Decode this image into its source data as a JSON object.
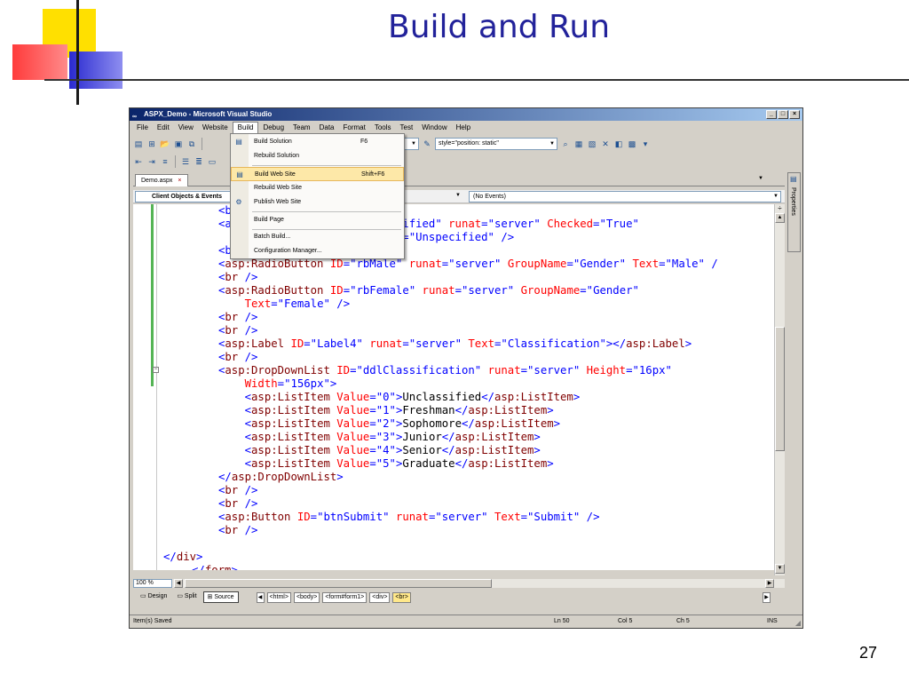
{
  "slide": {
    "title": "Build and Run",
    "page_number": "27"
  },
  "window": {
    "title": "ASPX_Demo - Microsoft Visual Studio",
    "buttons": [
      "_",
      "□",
      "×"
    ]
  },
  "menubar": {
    "items": [
      "File",
      "Edit",
      "View",
      "Website",
      "Build",
      "Debug",
      "Team",
      "Data",
      "Format",
      "Tools",
      "Test",
      "Window",
      "Help"
    ]
  },
  "toolbar": {
    "combo_target": "",
    "combo_style": "style=\"position: static\""
  },
  "document": {
    "tab_label": "Demo.aspx",
    "tab_close": "×",
    "nav_left": "Client Objects & Events",
    "nav_right": "(No Events)"
  },
  "build_menu": {
    "items": [
      {
        "label": "Build Solution",
        "shortcut": "F6",
        "icon": "build-solution-icon"
      },
      {
        "label": "Rebuild Solution",
        "shortcut": "",
        "icon": ""
      },
      {
        "label": "Build Web Site",
        "shortcut": "Shift+F6",
        "icon": "build-web-site-icon"
      },
      {
        "label": "Rebuild Web Site",
        "shortcut": "",
        "icon": ""
      },
      {
        "label": "Publish Web Site",
        "shortcut": "",
        "icon": "publish-icon"
      },
      {
        "label": "Build Page",
        "shortcut": "",
        "icon": ""
      },
      {
        "label": "Batch Build...",
        "shortcut": "",
        "icon": ""
      },
      {
        "label": "Configuration Manager...",
        "shortcut": "",
        "icon": ""
      }
    ]
  },
  "code": {
    "lines": [
      [
        {
          "t": "tag",
          "s": "<b"
        }
      ],
      [
        {
          "t": "tag",
          "s": "<a"
        },
        {
          "t": "pad",
          "s": "                      "
        },
        {
          "t": "val",
          "s": "specified\""
        },
        {
          "t": "text",
          "s": " "
        },
        {
          "t": "attr",
          "s": "runat"
        },
        {
          "t": "tag",
          "s": "="
        },
        {
          "t": "val",
          "s": "\"server\""
        },
        {
          "t": "text",
          "s": " "
        },
        {
          "t": "attr",
          "s": "Checked"
        },
        {
          "t": "tag",
          "s": "="
        },
        {
          "t": "val",
          "s": "\"True\""
        }
      ],
      [
        {
          "t": "pad",
          "s": "                          "
        },
        {
          "t": "val",
          "s": "xt=\"Unspecified\""
        },
        {
          "t": "text",
          "s": " "
        },
        {
          "t": "tag",
          "s": "/>"
        }
      ],
      [
        {
          "t": "tag",
          "s": "<b"
        }
      ],
      [
        {
          "t": "tag",
          "s": "<"
        },
        {
          "t": "el",
          "s": "asp:RadioButton"
        },
        {
          "t": "text",
          "s": " "
        },
        {
          "t": "attr",
          "s": "ID"
        },
        {
          "t": "tag",
          "s": "="
        },
        {
          "t": "val",
          "s": "\"rbMale\""
        },
        {
          "t": "text",
          "s": " "
        },
        {
          "t": "attr",
          "s": "runat"
        },
        {
          "t": "tag",
          "s": "="
        },
        {
          "t": "val",
          "s": "\"server\""
        },
        {
          "t": "text",
          "s": " "
        },
        {
          "t": "attr",
          "s": "GroupName"
        },
        {
          "t": "tag",
          "s": "="
        },
        {
          "t": "val",
          "s": "\"Gender\""
        },
        {
          "t": "text",
          "s": " "
        },
        {
          "t": "attr",
          "s": "Text"
        },
        {
          "t": "tag",
          "s": "="
        },
        {
          "t": "val",
          "s": "\"Male\""
        },
        {
          "t": "text",
          "s": " "
        },
        {
          "t": "tag",
          "s": "/"
        }
      ],
      [
        {
          "t": "tag",
          "s": "<"
        },
        {
          "t": "el",
          "s": "br"
        },
        {
          "t": "text",
          "s": " "
        },
        {
          "t": "tag",
          "s": "/>"
        }
      ],
      [
        {
          "t": "tag",
          "s": "<"
        },
        {
          "t": "el",
          "s": "asp:RadioButton"
        },
        {
          "t": "text",
          "s": " "
        },
        {
          "t": "attr",
          "s": "ID"
        },
        {
          "t": "tag",
          "s": "="
        },
        {
          "t": "val",
          "s": "\"rbFemale\""
        },
        {
          "t": "text",
          "s": " "
        },
        {
          "t": "attr",
          "s": "runat"
        },
        {
          "t": "tag",
          "s": "="
        },
        {
          "t": "val",
          "s": "\"server\""
        },
        {
          "t": "text",
          "s": " "
        },
        {
          "t": "attr",
          "s": "GroupName"
        },
        {
          "t": "tag",
          "s": "="
        },
        {
          "t": "val",
          "s": "\"Gender\""
        }
      ],
      [
        {
          "t": "pad",
          "s": "    "
        },
        {
          "t": "attr",
          "s": "Text"
        },
        {
          "t": "tag",
          "s": "="
        },
        {
          "t": "val",
          "s": "\"Female\""
        },
        {
          "t": "text",
          "s": " "
        },
        {
          "t": "tag",
          "s": "/>"
        }
      ],
      [
        {
          "t": "tag",
          "s": "<"
        },
        {
          "t": "el",
          "s": "br"
        },
        {
          "t": "text",
          "s": " "
        },
        {
          "t": "tag",
          "s": "/>"
        }
      ],
      [
        {
          "t": "tag",
          "s": "<"
        },
        {
          "t": "el",
          "s": "br"
        },
        {
          "t": "text",
          "s": " "
        },
        {
          "t": "tag",
          "s": "/>"
        }
      ],
      [
        {
          "t": "tag",
          "s": "<"
        },
        {
          "t": "el",
          "s": "asp:Label"
        },
        {
          "t": "text",
          "s": " "
        },
        {
          "t": "attr",
          "s": "ID"
        },
        {
          "t": "tag",
          "s": "="
        },
        {
          "t": "val",
          "s": "\"Label4\""
        },
        {
          "t": "text",
          "s": " "
        },
        {
          "t": "attr",
          "s": "runat"
        },
        {
          "t": "tag",
          "s": "="
        },
        {
          "t": "val",
          "s": "\"server\""
        },
        {
          "t": "text",
          "s": " "
        },
        {
          "t": "attr",
          "s": "Text"
        },
        {
          "t": "tag",
          "s": "="
        },
        {
          "t": "val",
          "s": "\"Classification\""
        },
        {
          "t": "tag",
          "s": "></"
        },
        {
          "t": "el",
          "s": "asp:Label"
        },
        {
          "t": "tag",
          "s": ">"
        }
      ],
      [
        {
          "t": "tag",
          "s": "<"
        },
        {
          "t": "el",
          "s": "br"
        },
        {
          "t": "text",
          "s": " "
        },
        {
          "t": "tag",
          "s": "/>"
        }
      ],
      [
        {
          "t": "tag",
          "s": "<"
        },
        {
          "t": "el",
          "s": "asp:DropDownList"
        },
        {
          "t": "text",
          "s": " "
        },
        {
          "t": "attr",
          "s": "ID"
        },
        {
          "t": "tag",
          "s": "="
        },
        {
          "t": "val",
          "s": "\"ddlClassification\""
        },
        {
          "t": "text",
          "s": " "
        },
        {
          "t": "attr",
          "s": "runat"
        },
        {
          "t": "tag",
          "s": "="
        },
        {
          "t": "val",
          "s": "\"server\""
        },
        {
          "t": "text",
          "s": " "
        },
        {
          "t": "attr",
          "s": "Height"
        },
        {
          "t": "tag",
          "s": "="
        },
        {
          "t": "val",
          "s": "\"16px\""
        }
      ],
      [
        {
          "t": "pad",
          "s": "    "
        },
        {
          "t": "attr",
          "s": "Width"
        },
        {
          "t": "tag",
          "s": "="
        },
        {
          "t": "val",
          "s": "\"156px\""
        },
        {
          "t": "tag",
          "s": ">"
        }
      ],
      [
        {
          "t": "pad",
          "s": "    "
        },
        {
          "t": "tag",
          "s": "<"
        },
        {
          "t": "el",
          "s": "asp:ListItem"
        },
        {
          "t": "text",
          "s": " "
        },
        {
          "t": "attr",
          "s": "Value"
        },
        {
          "t": "tag",
          "s": "="
        },
        {
          "t": "val",
          "s": "\"0\""
        },
        {
          "t": "tag",
          "s": ">"
        },
        {
          "t": "text",
          "s": "Unclassified"
        },
        {
          "t": "tag",
          "s": "</"
        },
        {
          "t": "el",
          "s": "asp:ListItem"
        },
        {
          "t": "tag",
          "s": ">"
        }
      ],
      [
        {
          "t": "pad",
          "s": "    "
        },
        {
          "t": "tag",
          "s": "<"
        },
        {
          "t": "el",
          "s": "asp:ListItem"
        },
        {
          "t": "text",
          "s": " "
        },
        {
          "t": "attr",
          "s": "Value"
        },
        {
          "t": "tag",
          "s": "="
        },
        {
          "t": "val",
          "s": "\"1\""
        },
        {
          "t": "tag",
          "s": ">"
        },
        {
          "t": "text",
          "s": "Freshman"
        },
        {
          "t": "tag",
          "s": "</"
        },
        {
          "t": "el",
          "s": "asp:ListItem"
        },
        {
          "t": "tag",
          "s": ">"
        }
      ],
      [
        {
          "t": "pad",
          "s": "    "
        },
        {
          "t": "tag",
          "s": "<"
        },
        {
          "t": "el",
          "s": "asp:ListItem"
        },
        {
          "t": "text",
          "s": " "
        },
        {
          "t": "attr",
          "s": "Value"
        },
        {
          "t": "tag",
          "s": "="
        },
        {
          "t": "val",
          "s": "\"2\""
        },
        {
          "t": "tag",
          "s": ">"
        },
        {
          "t": "text",
          "s": "Sophomore"
        },
        {
          "t": "tag",
          "s": "</"
        },
        {
          "t": "el",
          "s": "asp:ListItem"
        },
        {
          "t": "tag",
          "s": ">"
        }
      ],
      [
        {
          "t": "pad",
          "s": "    "
        },
        {
          "t": "tag",
          "s": "<"
        },
        {
          "t": "el",
          "s": "asp:ListItem"
        },
        {
          "t": "text",
          "s": " "
        },
        {
          "t": "attr",
          "s": "Value"
        },
        {
          "t": "tag",
          "s": "="
        },
        {
          "t": "val",
          "s": "\"3\""
        },
        {
          "t": "tag",
          "s": ">"
        },
        {
          "t": "text",
          "s": "Junior"
        },
        {
          "t": "tag",
          "s": "</"
        },
        {
          "t": "el",
          "s": "asp:ListItem"
        },
        {
          "t": "tag",
          "s": ">"
        }
      ],
      [
        {
          "t": "pad",
          "s": "    "
        },
        {
          "t": "tag",
          "s": "<"
        },
        {
          "t": "el",
          "s": "asp:ListItem"
        },
        {
          "t": "text",
          "s": " "
        },
        {
          "t": "attr",
          "s": "Value"
        },
        {
          "t": "tag",
          "s": "="
        },
        {
          "t": "val",
          "s": "\"4\""
        },
        {
          "t": "tag",
          "s": ">"
        },
        {
          "t": "text",
          "s": "Senior"
        },
        {
          "t": "tag",
          "s": "</"
        },
        {
          "t": "el",
          "s": "asp:ListItem"
        },
        {
          "t": "tag",
          "s": ">"
        }
      ],
      [
        {
          "t": "pad",
          "s": "    "
        },
        {
          "t": "tag",
          "s": "<"
        },
        {
          "t": "el",
          "s": "asp:ListItem"
        },
        {
          "t": "text",
          "s": " "
        },
        {
          "t": "attr",
          "s": "Value"
        },
        {
          "t": "tag",
          "s": "="
        },
        {
          "t": "val",
          "s": "\"5\""
        },
        {
          "t": "tag",
          "s": ">"
        },
        {
          "t": "text",
          "s": "Graduate"
        },
        {
          "t": "tag",
          "s": "</"
        },
        {
          "t": "el",
          "s": "asp:ListItem"
        },
        {
          "t": "tag",
          "s": ">"
        }
      ],
      [
        {
          "t": "tag",
          "s": "</"
        },
        {
          "t": "el",
          "s": "asp:DropDownList"
        },
        {
          "t": "tag",
          "s": ">"
        }
      ],
      [
        {
          "t": "tag",
          "s": "<"
        },
        {
          "t": "el",
          "s": "br"
        },
        {
          "t": "text",
          "s": " "
        },
        {
          "t": "tag",
          "s": "/>"
        }
      ],
      [
        {
          "t": "tag",
          "s": "<"
        },
        {
          "t": "el",
          "s": "br"
        },
        {
          "t": "text",
          "s": " "
        },
        {
          "t": "tag",
          "s": "/>"
        }
      ],
      [
        {
          "t": "tag",
          "s": "<"
        },
        {
          "t": "el",
          "s": "asp:Button"
        },
        {
          "t": "text",
          "s": " "
        },
        {
          "t": "attr",
          "s": "ID"
        },
        {
          "t": "tag",
          "s": "="
        },
        {
          "t": "val",
          "s": "\"btnSubmit\""
        },
        {
          "t": "text",
          "s": " "
        },
        {
          "t": "attr",
          "s": "runat"
        },
        {
          "t": "tag",
          "s": "="
        },
        {
          "t": "val",
          "s": "\"server\""
        },
        {
          "t": "text",
          "s": " "
        },
        {
          "t": "attr",
          "s": "Text"
        },
        {
          "t": "tag",
          "s": "="
        },
        {
          "t": "val",
          "s": "\"Submit\""
        },
        {
          "t": "text",
          "s": " "
        },
        {
          "t": "tag",
          "s": "/>"
        }
      ],
      [
        {
          "t": "tag",
          "s": "<"
        },
        {
          "t": "el",
          "s": "br"
        },
        {
          "t": "text",
          "s": " "
        },
        {
          "t": "tag",
          "s": "/>"
        }
      ],
      [],
      [
        {
          "t": "outdent",
          "s": ""
        },
        {
          "t": "tag",
          "s": "</"
        },
        {
          "t": "el",
          "s": "div"
        },
        {
          "t": "tag",
          "s": ">"
        }
      ],
      [
        {
          "t": "outdent2",
          "s": ""
        },
        {
          "t": "tag",
          "s": "</"
        },
        {
          "t": "el",
          "s": "form"
        },
        {
          "t": "tag",
          "s": ">"
        }
      ]
    ]
  },
  "zoom": "100 %",
  "views": {
    "design": "Design",
    "split": "Split",
    "source": "Source"
  },
  "breadcrumbs": [
    "<html>",
    "<body>",
    "<form#form1>",
    "<div>",
    "<br>"
  ],
  "status": {
    "message": "Item(s) Saved",
    "line": "Ln 50",
    "col": "Col 5",
    "ch": "Ch 5",
    "mode": "INS"
  },
  "properties_label": "Properties",
  "colors": {
    "slide_title": "#22229a",
    "tag": "#0000ff",
    "attribute": "#ff0000",
    "element": "#800000",
    "menu_highlight": "#fde8a8"
  }
}
